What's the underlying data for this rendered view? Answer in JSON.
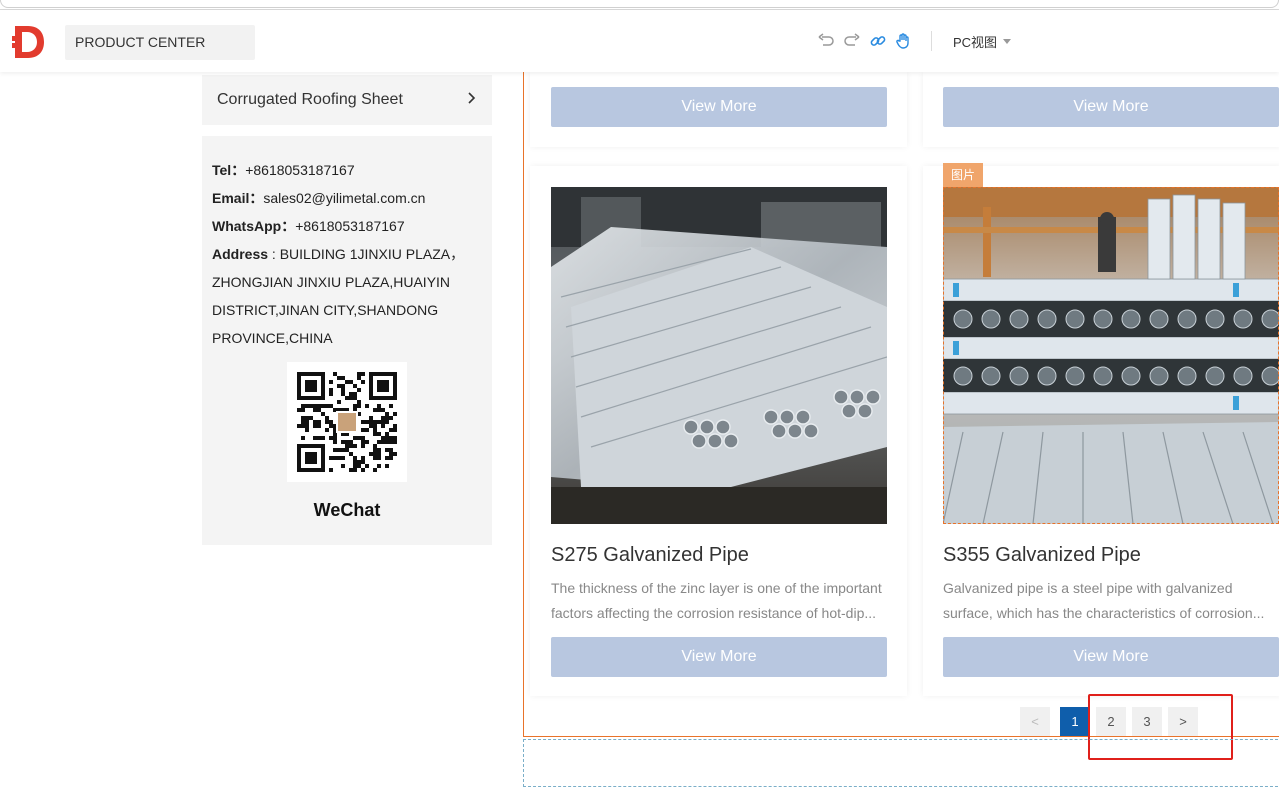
{
  "toolbar": {
    "page_select": "PRODUCT CENTER",
    "view_select": "PC视图",
    "icons": [
      "undo-icon",
      "redo-icon",
      "link-icon",
      "hand-icon"
    ],
    "accent_color": "#e23b2e"
  },
  "sidebar": {
    "category_item": "Corrugated Roofing Sheet",
    "contact": {
      "tel_label": "Tel",
      "tel_value": "+8618053187167",
      "email_label": "Email",
      "email_value": "sales02@yilimetal.com.cn",
      "whatsapp_label": "WhatsApp",
      "whatsapp_value": "+8618053187167",
      "address_label": "Address",
      "address_lines": [
        " : BUILDING 1JINXIU PLAZA，",
        "ZHONGJIAN JINXIU PLAZA,HUAIYIN",
        "DISTRICT,JINAN CITY,SHANDONG",
        "PROVINCE,CHINA"
      ],
      "wechat_label": "WeChat"
    }
  },
  "products": {
    "view_more_label": "View More",
    "image_badge": "图片",
    "items": [
      {
        "title": "S275 Galvanized Pipe",
        "desc_lines": [
          "The thickness of the zinc layer is one of the important",
          "factors affecting the corrosion resistance of hot-dip..."
        ]
      },
      {
        "title": "S355 Galvanized Pipe",
        "desc_lines": [
          "Galvanized pipe is a steel pipe with galvanized",
          "surface, which has the characteristics of corrosion..."
        ]
      }
    ]
  },
  "pagination": {
    "prev": "<",
    "pages": [
      "1",
      "2",
      "3"
    ],
    "next": ">",
    "active_page": "1"
  }
}
